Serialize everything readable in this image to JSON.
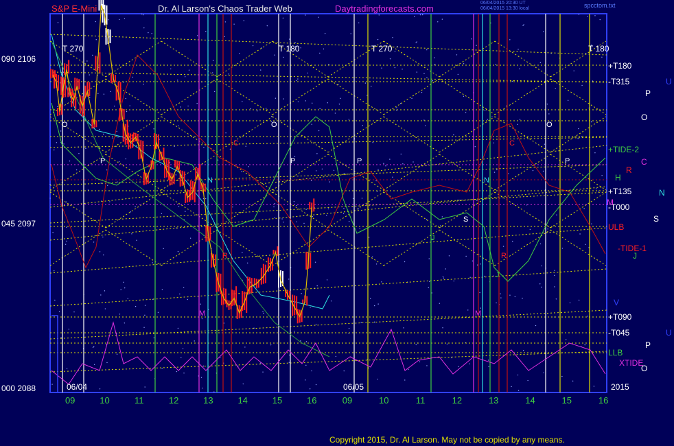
{
  "header": {
    "left": "S&P E-Mini",
    "center": "Dr. Al Larson's Chaos Trader Web",
    "site": "Daytradingforecasts.com",
    "stamp_line1": "06/04/2015 20:30 UT",
    "stamp_line2": "06/04/2015 13:30 local",
    "file": "spcctom.txt"
  },
  "footer": {
    "copyright": "Copyright 2015, Dr. Al Larson. May not be copied by any means."
  },
  "colors": {
    "background": "#000058",
    "price": "#ff2020",
    "grid_yellow": "#e0e000",
    "cyan": "#30e0e0",
    "green": "#40d040",
    "magenta": "#e030e0",
    "blue": "#3040ff",
    "dark_red": "#c01010"
  },
  "chart_data": {
    "type": "line",
    "title": "S&P E-Mini",
    "y_axis": {
      "ticks": [
        {
          "label": "090  2106",
          "value": 2106
        },
        {
          "label": "045  2097",
          "value": 2097
        },
        {
          "label": "000  2088",
          "value": 2088
        }
      ],
      "ylim": [
        2088,
        2107.8
      ]
    },
    "x_axis": {
      "range": [
        8.4,
        16.0
      ],
      "day1_hours": [
        "09",
        "10",
        "11",
        "12",
        "13",
        "14",
        "15",
        "16"
      ],
      "day2_hours": [
        "09",
        "10",
        "11",
        "12",
        "13",
        "14",
        "15",
        "16"
      ],
      "date_labels": [
        "06/04",
        "06/05"
      ],
      "year_label": "2015"
    },
    "top_labels": [
      "T  270",
      "T  180",
      "T  270",
      "T  180"
    ],
    "right_labels": [
      {
        "text": "+T180",
        "color": "#ffffff"
      },
      {
        "text": "-T315",
        "color": "#ffffff"
      },
      {
        "text": "+TIDE-2",
        "color": "#40d040"
      },
      {
        "text": "+T135",
        "color": "#ffffff"
      },
      {
        "text": "-T000",
        "color": "#ffffff"
      },
      {
        "text": "ULB",
        "color": "#ff2020"
      },
      {
        "text": "-TIDE-1",
        "color": "#ff2020"
      },
      {
        "text": "+T090",
        "color": "#ffffff"
      },
      {
        "text": "-T045",
        "color": "#ffffff"
      },
      {
        "text": "LLB",
        "color": "#40d040"
      },
      {
        "text": "XTIDE",
        "color": "#e030e0"
      }
    ],
    "planet_labels": [
      "U",
      "P",
      "O",
      "C",
      "R",
      "H",
      "N",
      "M",
      "S",
      "J",
      "V",
      "U",
      "P",
      "O"
    ],
    "series": [
      {
        "name": "S&P E-Mini",
        "color": "#ff2020",
        "points": [
          [
            8.5,
            2105.2
          ],
          [
            8.6,
            2104.8
          ],
          [
            8.7,
            2103.2
          ],
          [
            8.8,
            2104.5
          ],
          [
            8.9,
            2105.5
          ],
          [
            9.0,
            2104.2
          ],
          [
            9.1,
            2103.8
          ],
          [
            9.2,
            2104.6
          ],
          [
            9.35,
            2103.5
          ],
          [
            9.5,
            2104.3
          ],
          [
            9.7,
            2102.5
          ],
          [
            9.8,
            2105.8
          ],
          [
            9.9,
            2109.0
          ],
          [
            10.0,
            2108.5
          ],
          [
            10.1,
            2107.2
          ],
          [
            10.25,
            2105.0
          ],
          [
            10.4,
            2104.2
          ],
          [
            10.5,
            2103.0
          ],
          [
            10.6,
            2102.0
          ],
          [
            10.75,
            2101.5
          ],
          [
            10.9,
            2101.8
          ],
          [
            11.05,
            2101.0
          ],
          [
            11.2,
            2099.5
          ],
          [
            11.35,
            2100.2
          ],
          [
            11.5,
            2101.5
          ],
          [
            11.65,
            2100.8
          ],
          [
            11.8,
            2100.0
          ],
          [
            11.95,
            2099.5
          ],
          [
            12.1,
            2100.2
          ],
          [
            12.25,
            2099.5
          ],
          [
            12.4,
            2098.5
          ],
          [
            12.55,
            2098.8
          ],
          [
            12.7,
            2099.8
          ],
          [
            12.85,
            2099.0
          ],
          [
            13.0,
            2096.5
          ],
          [
            13.15,
            2095.0
          ],
          [
            13.3,
            2093.8
          ],
          [
            13.45,
            2093.0
          ],
          [
            13.6,
            2092.6
          ],
          [
            13.75,
            2093.0
          ],
          [
            13.9,
            2092.2
          ],
          [
            14.05,
            2092.8
          ],
          [
            14.2,
            2093.6
          ],
          [
            14.4,
            2093.8
          ],
          [
            14.6,
            2094.2
          ],
          [
            14.8,
            2094.8
          ],
          [
            14.95,
            2095.5
          ],
          [
            15.1,
            2094.0
          ],
          [
            15.3,
            2093.2
          ],
          [
            15.5,
            2092.5
          ],
          [
            15.65,
            2092.0
          ],
          [
            15.8,
            2092.8
          ],
          [
            15.9,
            2095.0
          ],
          [
            16.0,
            2098.0
          ]
        ]
      }
    ]
  }
}
